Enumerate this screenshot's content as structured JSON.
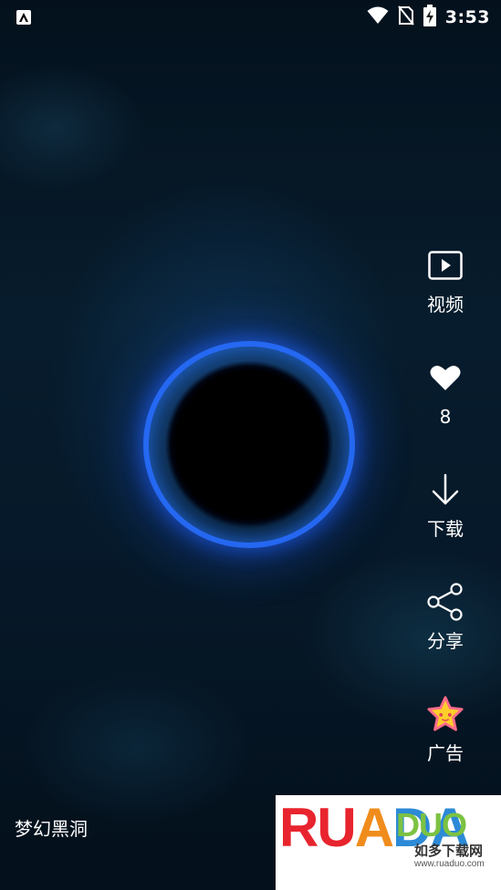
{
  "status_bar": {
    "time": "3:53",
    "icons": [
      "app-notification-icon",
      "wifi-icon",
      "no-sim-icon",
      "battery-charging-icon"
    ]
  },
  "actions": [
    {
      "id": "video",
      "icon": "video-play-icon",
      "label": "视频"
    },
    {
      "id": "like",
      "icon": "heart-icon",
      "label": "8"
    },
    {
      "id": "download",
      "icon": "download-arrow-icon",
      "label": "下载"
    },
    {
      "id": "share",
      "icon": "share-icon",
      "label": "分享"
    },
    {
      "id": "ad",
      "icon": "star-badge-icon",
      "label": "广告"
    }
  ],
  "wallpaper": {
    "title": "梦幻黑洞"
  },
  "watermark": {
    "logo_text": "RUADADUO",
    "tagline": "如多下载网",
    "url": "www.ruaduo.com"
  },
  "colors": {
    "accent_blue": "#2c6bff",
    "background": "#04101c"
  }
}
